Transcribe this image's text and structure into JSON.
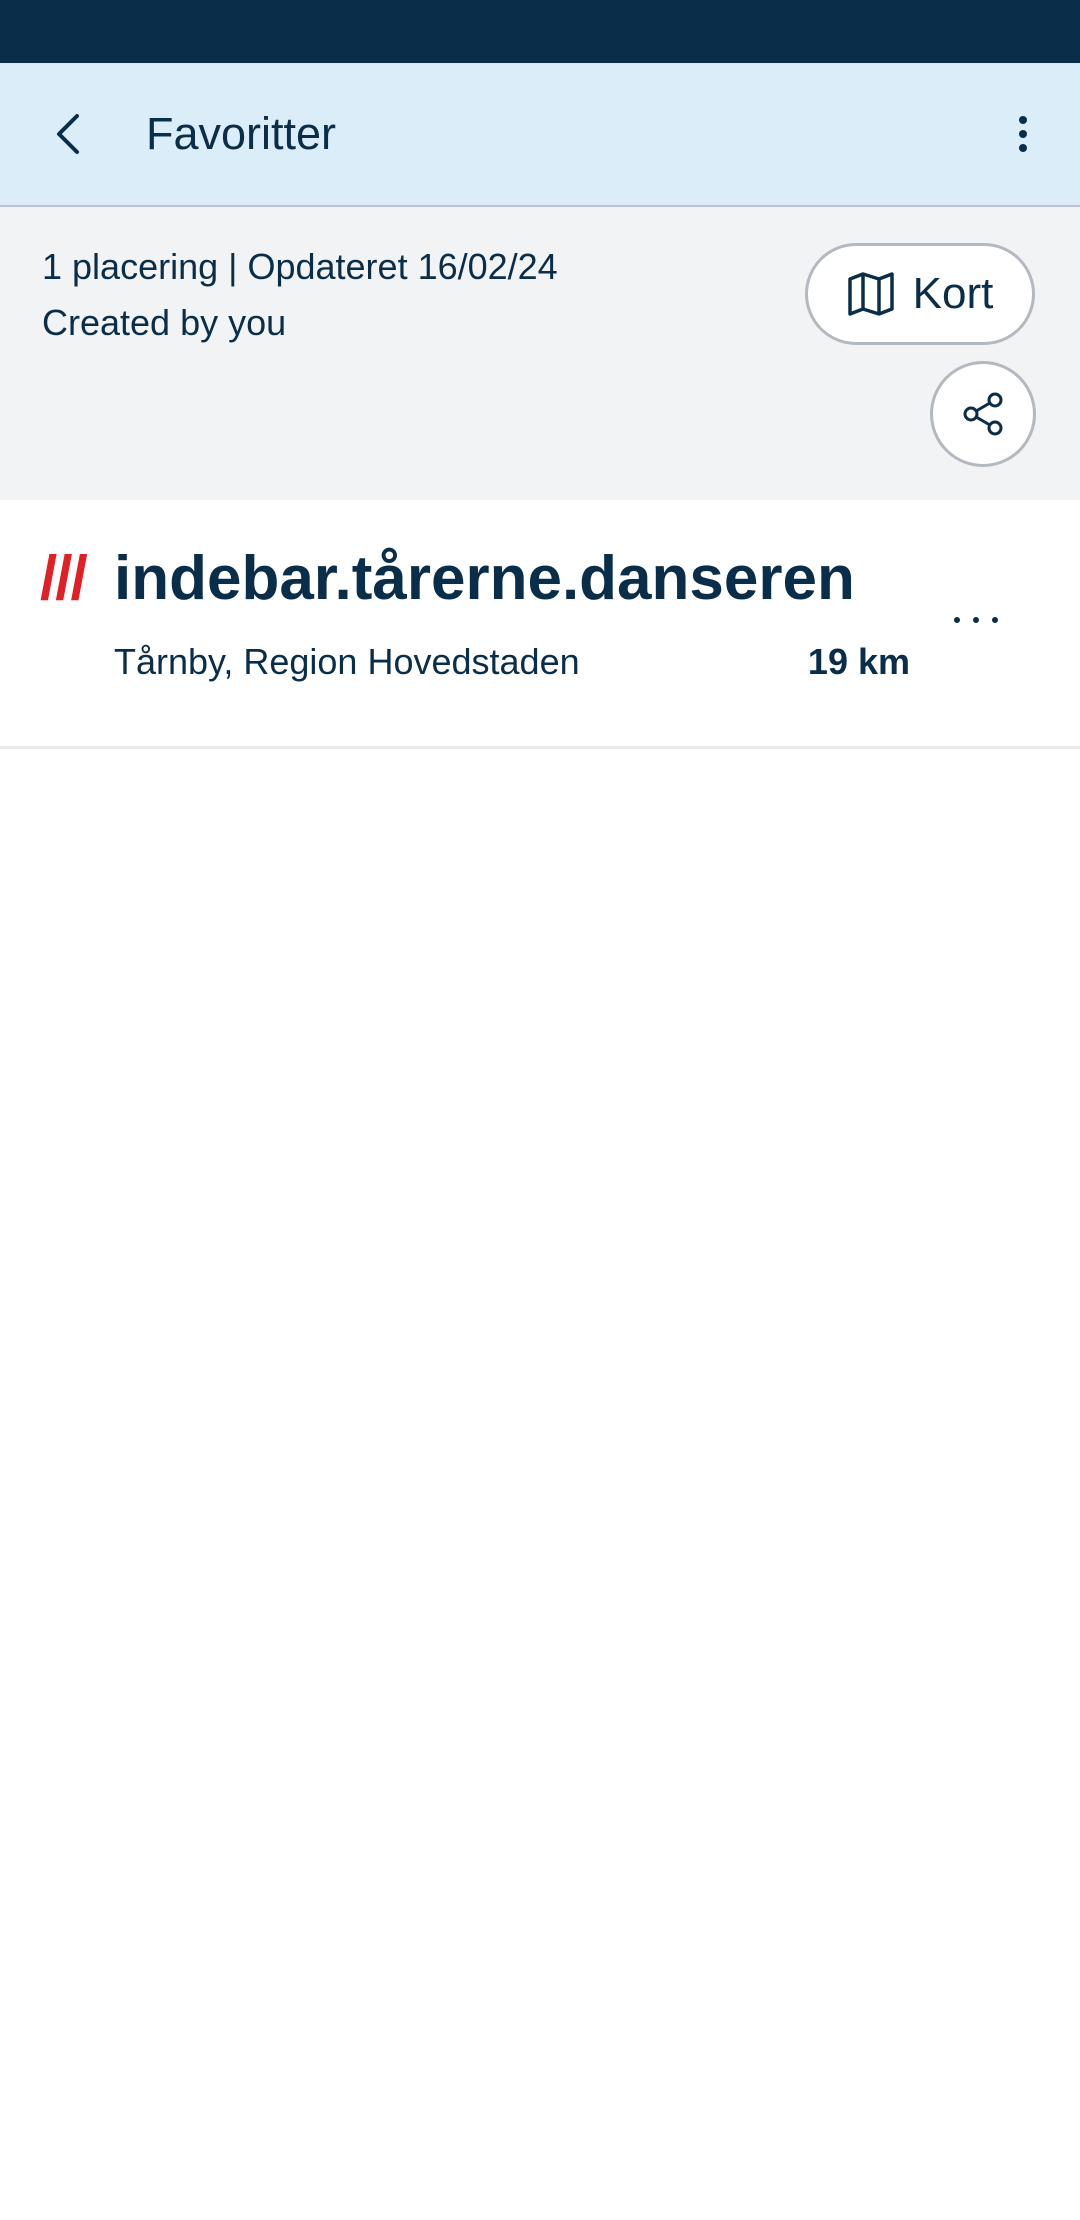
{
  "app_bar": {
    "title": "Favoritter",
    "back_icon": "chevron-left-icon",
    "menu_icon": "vertical-dots-icon"
  },
  "info": {
    "summary": "1 placering | Opdateret 16/02/24",
    "creator": "Created by you",
    "map_button_label": "Kort",
    "map_icon": "map-icon",
    "share_icon": "share-icon"
  },
  "list": {
    "items": [
      {
        "slashes": "///",
        "address": "indebar.tårerne.danseren",
        "location": "Tårnby, Region Hovedstaden",
        "distance": "19 km",
        "more_icon": "horizontal-dots-icon"
      }
    ]
  },
  "colors": {
    "primary": "#0a2e4a",
    "accent_red": "#e11f26",
    "app_bar_bg": "#dbedf8",
    "panel_bg": "#f2f3f5"
  }
}
